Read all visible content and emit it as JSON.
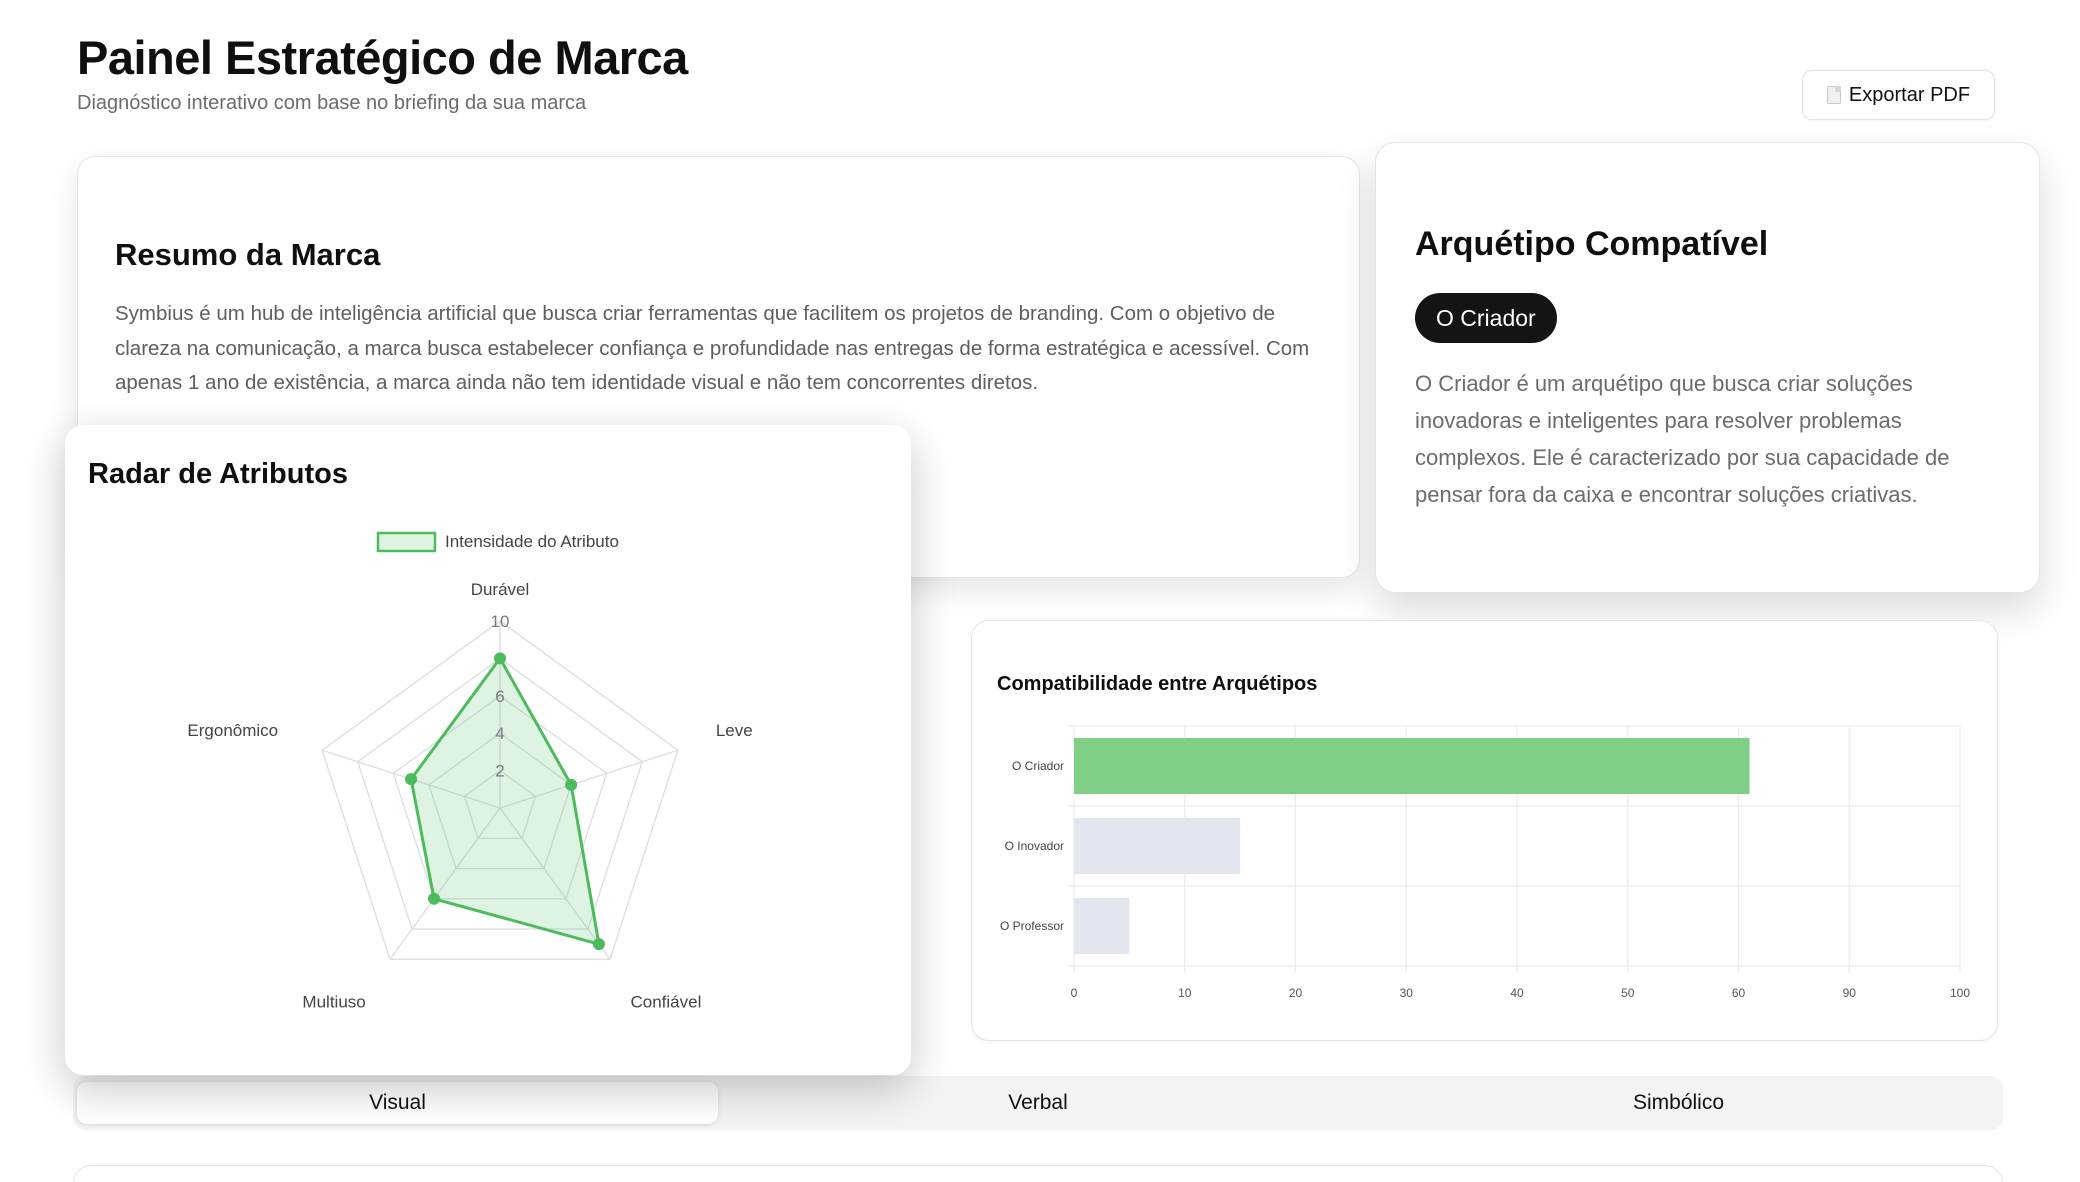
{
  "header": {
    "title": "Painel Estratégico de Marca",
    "subtitle": "Diagnóstico interativo com base no briefing da sua marca",
    "export_label": "Exportar PDF",
    "export_icon": "document-icon"
  },
  "summary": {
    "title": "Resumo da Marca",
    "text": "Symbius é um hub de inteligência artificial que busca criar ferramentas que facilitem os projetos de branding. Com o objetivo de clareza na comunicação, a marca busca estabelecer confiança e profundidade nas entregas de forma estratégica e acessível. Com apenas 1 ano de existência, a marca ainda não tem identidade visual e não tem concorrentes diretos."
  },
  "archetype": {
    "title": "Arquétipo Compatível",
    "badge": "O Criador",
    "description": "O Criador é um arquétipo que busca criar soluções inovadoras e inteligentes para resolver problemas complexos. Ele é caracterizado por sua capacidade de pensar fora da caixa e encontrar soluções criativas."
  },
  "radar": {
    "title": "Radar de Atributos",
    "legend": "Intensidade do Atributo",
    "ticks": [
      "2",
      "4",
      "6",
      "10"
    ]
  },
  "compat": {
    "title": "Compatibilidade entre Arquétipos"
  },
  "chart_data": [
    {
      "type": "radar",
      "title": "Radar de Atributos",
      "categories": [
        "Durável",
        "Leve",
        "Confiável",
        "Multiuso",
        "Ergonômico"
      ],
      "series": [
        {
          "name": "Intensidade do Atributo",
          "values": [
            8,
            4,
            9,
            6,
            5
          ]
        }
      ],
      "range": [
        0,
        10
      ],
      "tick_labels": [
        "2",
        "4",
        "6",
        "10"
      ],
      "colors": {
        "line": "#4cbb5c",
        "fill": "rgba(76,187,92,0.18)",
        "grid": "#dcdce4"
      }
    },
    {
      "type": "bar",
      "orientation": "horizontal",
      "title": "Compatibilidade entre Arquétipos",
      "categories": [
        "O Criador",
        "O Inovador",
        "O Professor"
      ],
      "values": [
        61,
        15,
        5
      ],
      "xticks": [
        "0",
        "10",
        "20",
        "30",
        "40",
        "50",
        "60",
        "90",
        "100"
      ],
      "xlim": [
        0,
        80
      ],
      "colors": [
        "#7fcf86",
        "#e2e6ee",
        "#e2e6ee"
      ]
    }
  ],
  "tabs": [
    {
      "label": "Visual",
      "active": true
    },
    {
      "label": "Verbal",
      "active": false
    },
    {
      "label": "Simbólico",
      "active": false
    }
  ]
}
